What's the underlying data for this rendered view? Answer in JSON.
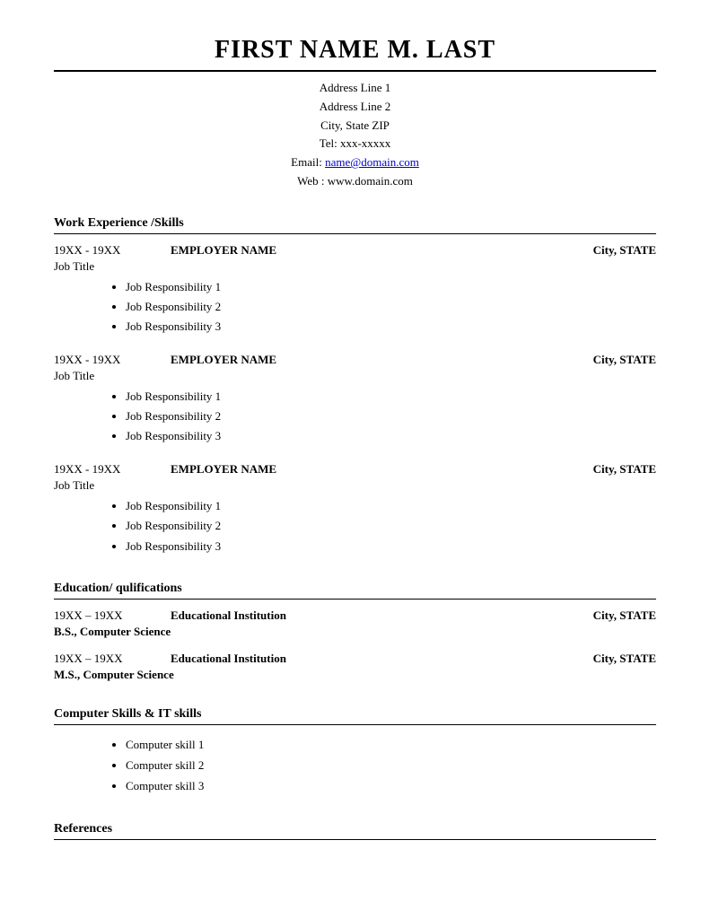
{
  "header": {
    "name": "FIRST NAME M. LAST",
    "address_line1": "Address Line 1",
    "address_line2": "Address Line 2",
    "city_state_zip": "City, State ZIP",
    "tel": "Tel: xxx-xxxxx",
    "email_label": "Email: ",
    "email_link": "name@domain.com",
    "email_href": "mailto:name@domain.com",
    "web": "Web : www.domain.com"
  },
  "work_experience": {
    "section_title": "Work Experience /Skills",
    "jobs": [
      {
        "dates": "19XX - 19XX",
        "employer": "EMPLOYER NAME",
        "location": "City, STATE",
        "title": "Job Title",
        "responsibilities": [
          "Job Responsibility 1",
          "Job Responsibility 2",
          "Job Responsibility 3"
        ]
      },
      {
        "dates": "19XX - 19XX",
        "employer": "EMPLOYER NAME",
        "location": "City, STATE",
        "title": "Job Title",
        "responsibilities": [
          "Job Responsibility 1",
          "Job Responsibility 2",
          "Job Responsibility 3"
        ]
      },
      {
        "dates": "19XX - 19XX",
        "employer": "EMPLOYER NAME",
        "location": "City, STATE",
        "title": "Job Title",
        "responsibilities": [
          "Job Responsibility 1",
          "Job Responsibility 2",
          "Job Responsibility 3"
        ]
      }
    ]
  },
  "education": {
    "section_title": "Education/ qulifications",
    "entries": [
      {
        "dates": "19XX – 19XX",
        "institution": "Educational Institution",
        "location": "City, STATE",
        "degree": "B.S., Computer Science"
      },
      {
        "dates": "19XX – 19XX",
        "institution": "Educational Institution",
        "location": "City, STATE",
        "degree": "M.S., Computer Science"
      }
    ]
  },
  "computer_skills": {
    "section_title": "Computer Skills & IT skills",
    "skills": [
      "Computer skill 1",
      "Computer skill 2",
      "Computer skill 3"
    ]
  },
  "references": {
    "section_title": "References"
  }
}
